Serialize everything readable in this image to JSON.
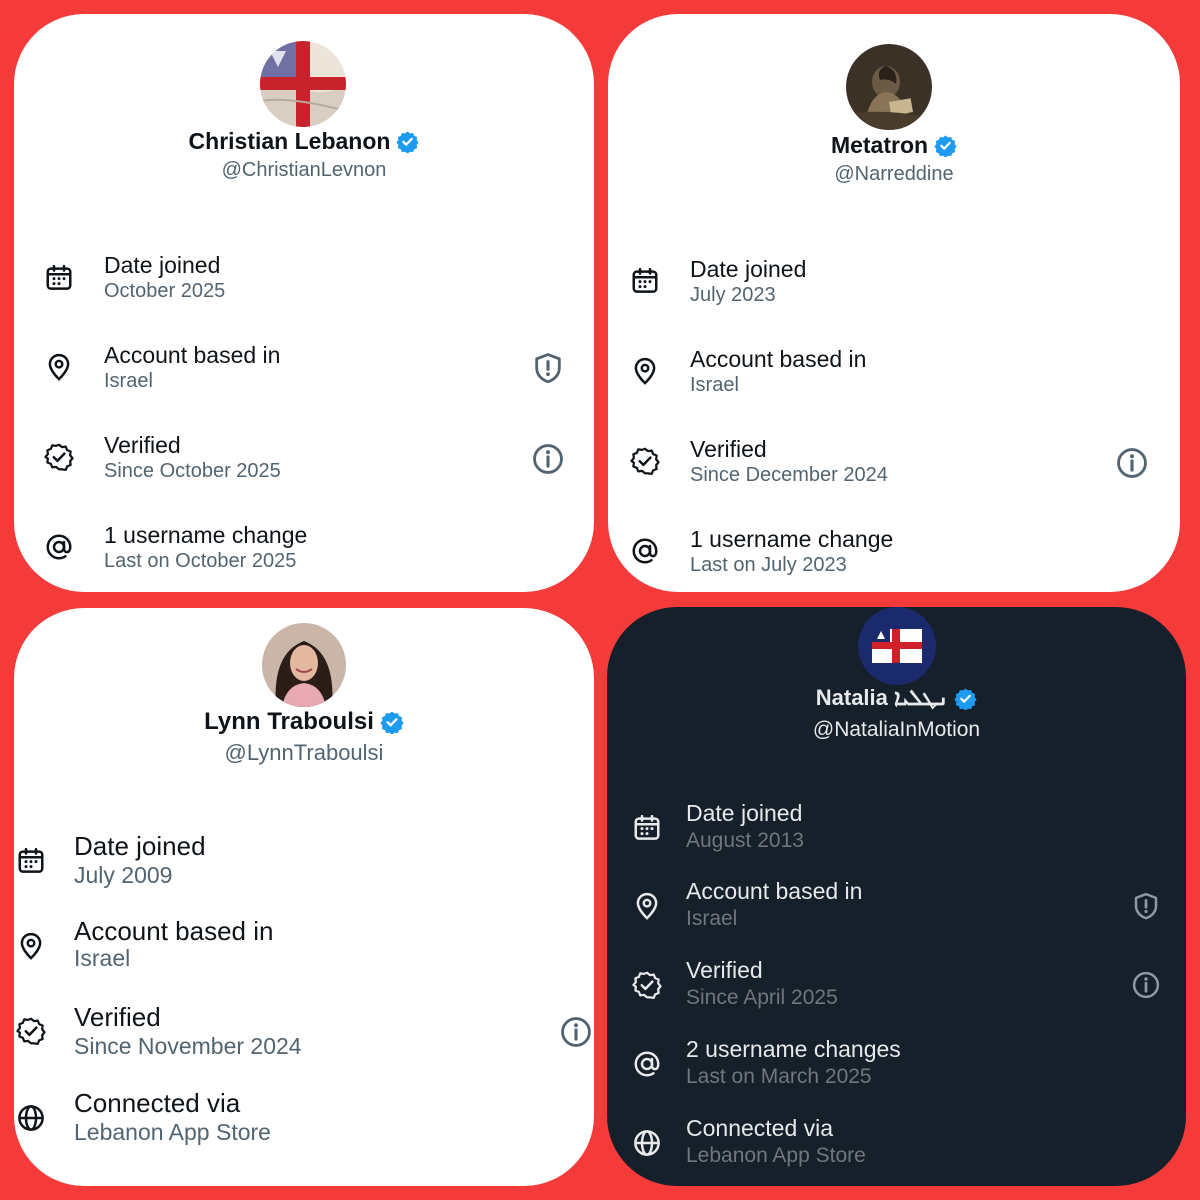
{
  "panels": [
    {
      "name": "Christian Lebanon",
      "handle": "@ChristianLevnon",
      "rows": [
        {
          "label": "Date joined",
          "value": "October 2025"
        },
        {
          "label": "Account based in",
          "value": "Israel"
        },
        {
          "label": "Verified",
          "value": "Since October 2025"
        },
        {
          "label": "1 username change",
          "value": "Last on October 2025"
        }
      ]
    },
    {
      "name": "Metatron",
      "handle": "@Narreddine",
      "rows": [
        {
          "label": "Date joined",
          "value": "July 2023"
        },
        {
          "label": "Account based in",
          "value": "Israel"
        },
        {
          "label": "Verified",
          "value": "Since December 2024"
        },
        {
          "label": "1 username change",
          "value": "Last on July 2023"
        }
      ]
    },
    {
      "name": "Lynn Traboulsi",
      "handle": "@LynnTraboulsi",
      "rows": [
        {
          "label": "Date joined",
          "value": "July 2009"
        },
        {
          "label": "Account based in",
          "value": "Israel"
        },
        {
          "label": "Verified",
          "value": "Since November 2024"
        },
        {
          "label": "Connected via",
          "value": "Lebanon App Store"
        }
      ]
    },
    {
      "name": "Natalia ܢܛܠܝܐ",
      "handle": "@NataliaInMotion",
      "rows": [
        {
          "label": "Date joined",
          "value": "August 2013"
        },
        {
          "label": "Account based in",
          "value": "Israel"
        },
        {
          "label": "Verified",
          "value": "Since April 2025"
        },
        {
          "label": "2 username changes",
          "value": "Last on March 2025"
        },
        {
          "label": "Connected via",
          "value": "Lebanon App Store"
        }
      ]
    }
  ],
  "colors": {
    "background": "#f53a3a",
    "verified_badge": "#1d9bf0",
    "dark_panel": "#15202b",
    "light_panel": "#ffffff"
  },
  "icons": [
    "calendar-icon",
    "location-pin-icon",
    "verified-badge-icon",
    "at-sign-icon",
    "globe-icon",
    "shield-alert-icon",
    "info-icon"
  ]
}
